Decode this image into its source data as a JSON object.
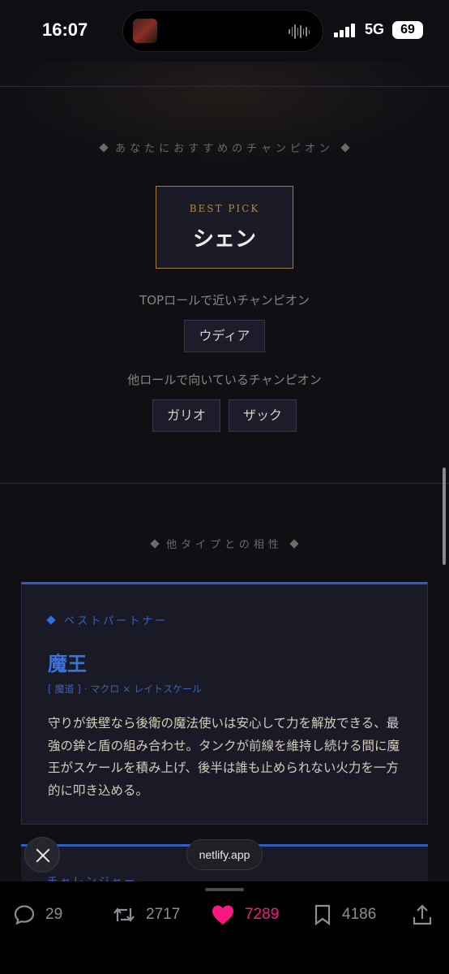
{
  "status_bar": {
    "time": "16:07",
    "network": "5G",
    "battery": "69"
  },
  "recommend": {
    "section_title": "あなたにおすすめのチャンピオン",
    "best_pick_label": "BEST PICK",
    "best_pick_name": "シェン",
    "top_role_label": "TOPロールで近いチャンピオン",
    "top_role_champions": [
      "ウディア"
    ],
    "other_role_label": "他ロールで向いているチャンピオン",
    "other_role_champions": [
      "ガリオ",
      "ザック"
    ]
  },
  "compat": {
    "section_title": "他タイプとの相性",
    "card": {
      "tag": "ベストパートナー",
      "title": "魔王",
      "subtitle": "[ 魔道 ] · マクロ × レイトスケール",
      "body": "守りが鉄壁なら後衛の魔法使いは安心して力を解放できる、最強の鉾と盾の組み合わせ。タンクが前線を維持し続ける間に魔王がスケールを積み上げ、後半は誰も止められない火力を一方的に叩き込める。"
    },
    "card2_tag": "チャレンジャー"
  },
  "overlay": {
    "url": "netlify.app"
  },
  "actions": {
    "replies": "29",
    "reposts": "2717",
    "likes": "7289",
    "bookmarks": "4186"
  },
  "colors": {
    "accent_gold": "#a47d3f",
    "accent_blue": "#2d5fc2",
    "like_pink": "#f91880"
  }
}
